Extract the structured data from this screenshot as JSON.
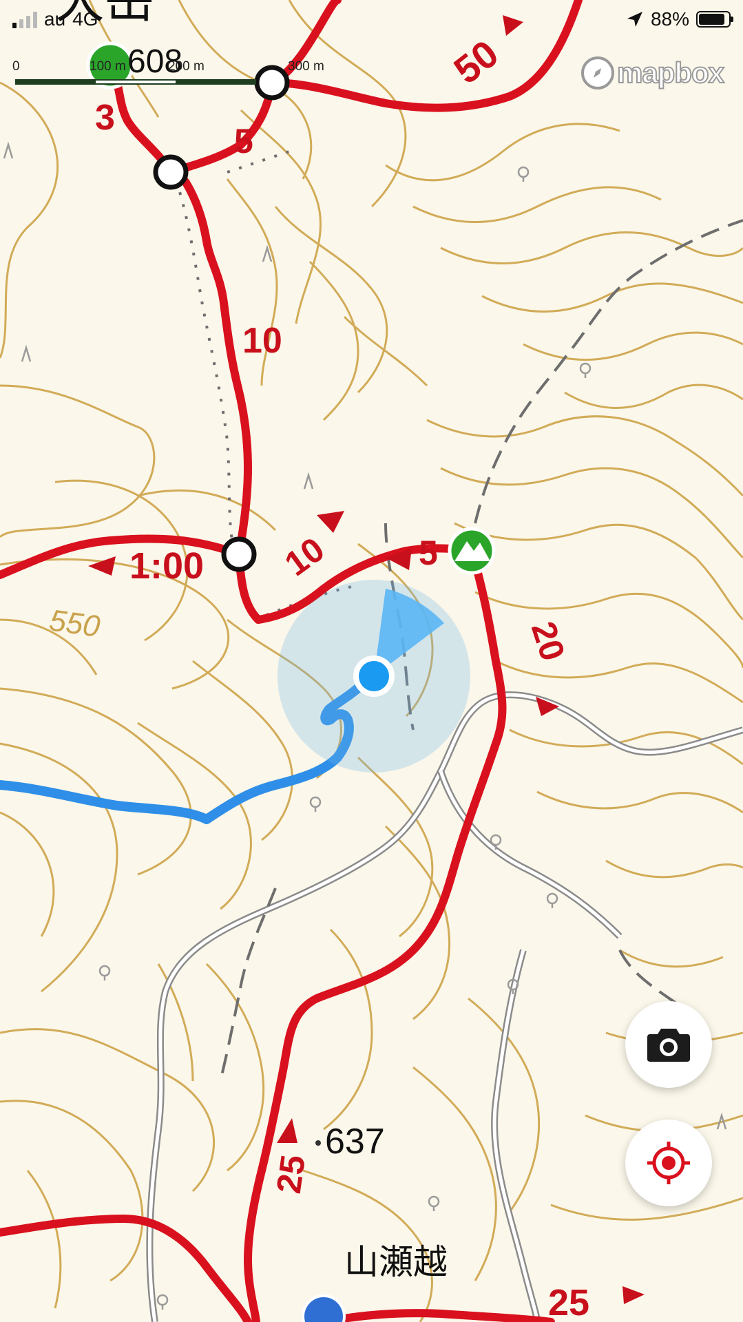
{
  "status_bar": {
    "carrier": "au",
    "network": "4G",
    "battery_text": "88%",
    "battery_level": 0.88
  },
  "scale_bar": {
    "labels": [
      "0",
      "100 m",
      "200 m",
      "300 m"
    ]
  },
  "attribution": {
    "brand": "mapbox"
  },
  "map": {
    "place_name_top": "大岳",
    "summit_elevation_top": "608",
    "place_name_pass": "山瀬越",
    "spot_elevation": "637",
    "contour_label": "550",
    "trail_times": {
      "t_top_50": "50",
      "t_top_3": "3",
      "t_top_5": "5",
      "t_left_10": "10",
      "t_mid_100": "1:00",
      "t_mid_10": "10",
      "t_mid_5": "5",
      "t_right_20": "20",
      "t_bottom_25": "25",
      "t_bottom_right_25": "25"
    }
  },
  "buttons": {
    "camera": "camera-icon",
    "locate": "target-icon"
  },
  "colors": {
    "trail_red": "#d9111e",
    "track_blue": "#2f8fe8",
    "contour_brown": "#c9a24c",
    "map_bg": "#fbf7ea",
    "summit_green": "#2aa52a",
    "location_blue": "#1a9af0"
  }
}
